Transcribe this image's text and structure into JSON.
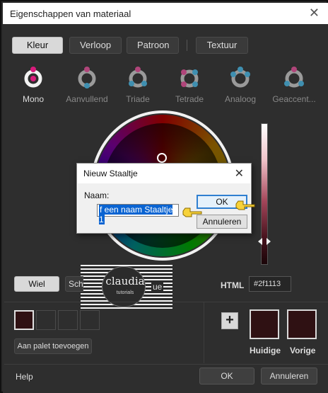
{
  "window": {
    "title": "Eigenschappen van materiaal"
  },
  "tabs": [
    "Kleur",
    "Verloop",
    "Patroon",
    "Textuur"
  ],
  "harmonies": [
    {
      "label": "Mono",
      "icon": "mono-harmony-icon"
    },
    {
      "label": "Aanvullend",
      "icon": "complementary-harmony-icon"
    },
    {
      "label": "Triade",
      "icon": "triad-harmony-icon"
    },
    {
      "label": "Tetrade",
      "icon": "tetrad-harmony-icon"
    },
    {
      "label": "Analoog",
      "icon": "analogous-harmony-icon"
    },
    {
      "label": "Geaccent...",
      "icon": "accented-harmony-icon"
    }
  ],
  "dialog": {
    "title": "Nieuw Staaltje",
    "name_label": "Naam:",
    "name_value": "f een naam Staaltje 1",
    "ok_label": "OK",
    "cancel_label": "Annuleren"
  },
  "view": {
    "wheel_label": "Wiel",
    "second_label": "Sch",
    "third_label": "ue"
  },
  "watermark": {
    "name": "claudia",
    "sub": "tutorials"
  },
  "html": {
    "label": "HTML",
    "value": "#2f1113"
  },
  "palette": {
    "add_label": "Aan palet toevoegen"
  },
  "current": {
    "label": "Huidige",
    "color": "#2f1113"
  },
  "previous": {
    "label": "Vorige",
    "color": "#2f1113"
  },
  "footer": {
    "help_label": "Help",
    "ok_label": "OK",
    "cancel_label": "Annuleren"
  },
  "colors": {
    "accent": "#d81b7c",
    "ring_accent": "#2d8fb8",
    "dialog_ok_border": "#2f7fd0"
  }
}
